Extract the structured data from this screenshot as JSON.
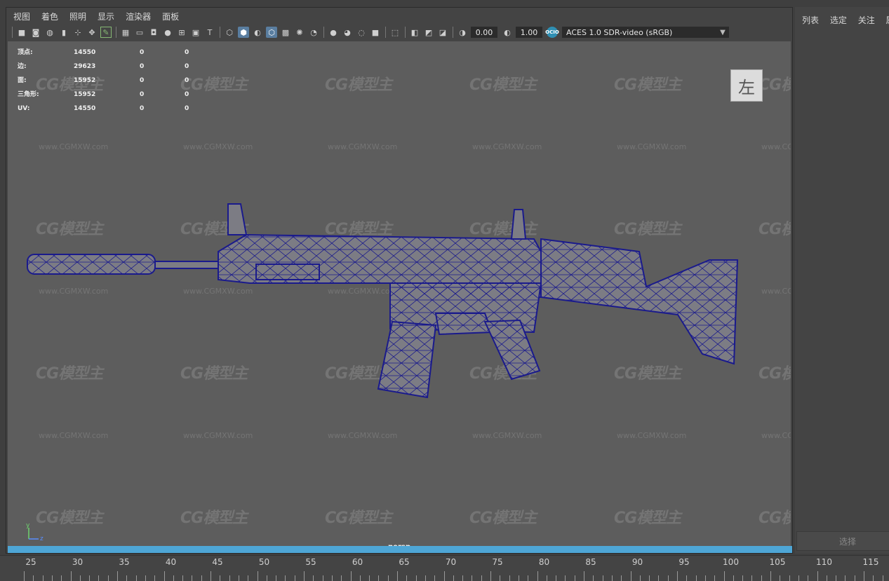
{
  "panel_menu": [
    "视图",
    "着色",
    "照明",
    "显示",
    "渲染器",
    "面板"
  ],
  "toolbar": {
    "near_clip_value": "0.00",
    "gain_value": "1.00",
    "color_space": "ACES 1.0 SDR-video (sRGB)",
    "icons": [
      "camera-select-icon",
      "camera-attributes-icon",
      "bookmark-icon",
      "image-plane-icon",
      "pivot-icon",
      "grease-pencil-icon",
      "grid-icon",
      "film-gate-icon",
      "resolution-gate-icon",
      "gate-mask-icon",
      "field-chart-icon",
      "safe-action-icon",
      "safe-title-icon",
      "wireframe-icon",
      "smooth-shade-icon",
      "default-material-icon",
      "wireframe-on-shaded-icon",
      "textured-icon",
      "use-all-lights-icon",
      "shadows-icon",
      "ambient-occlusion-icon",
      "motion-blur-icon",
      "anti-aliasing-icon",
      "depth-of-field-icon",
      "isolate-select-icon",
      "xray-icon",
      "xray-joints-icon",
      "xray-components-icon",
      "exposure-icon",
      "gamma-icon",
      "color-management-icon"
    ]
  },
  "hud": {
    "rows": [
      {
        "label": "顶点:",
        "v1": "14550",
        "v2": "0",
        "v3": "0"
      },
      {
        "label": "边:",
        "v1": "29623",
        "v2": "0",
        "v3": "0"
      },
      {
        "label": "面:",
        "v1": "15952",
        "v2": "0",
        "v3": "0"
      },
      {
        "label": "三角形:",
        "v1": "15952",
        "v2": "0",
        "v3": "0"
      },
      {
        "label": "UV:",
        "v1": "14550",
        "v2": "0",
        "v3": "0"
      }
    ]
  },
  "view_cube_label": "左",
  "camera_name": "persp",
  "axis_labels": {
    "y": "y",
    "z": "z"
  },
  "watermark": {
    "logo": "CG模型主",
    "url": "www.CGMXW.com"
  },
  "side_panel": {
    "menu": [
      "列表",
      "选定",
      "关注",
      "属"
    ],
    "select_button": "选择"
  },
  "timeline": {
    "ticks": [
      "25",
      "30",
      "35",
      "40",
      "45",
      "50",
      "55",
      "60",
      "65",
      "70",
      "75",
      "80",
      "85",
      "90",
      "95",
      "100",
      "105",
      "110",
      "115"
    ]
  },
  "colors": {
    "viewport_bg": "#5d5d5d",
    "wireframe": "#1a1a8c",
    "highlight_bar": "#4ea6d6",
    "active_icon": "#5a7ea0"
  }
}
